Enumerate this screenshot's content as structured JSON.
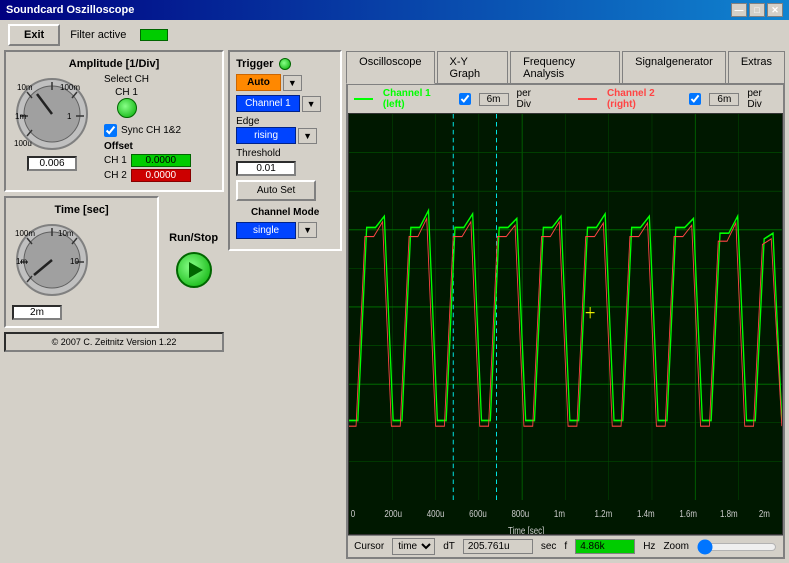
{
  "window": {
    "title": "Soundcard Oszilloscope",
    "min_btn": "—",
    "max_btn": "□",
    "close_btn": "✕"
  },
  "toolbar": {
    "exit_label": "Exit",
    "filter_active_label": "Filter active"
  },
  "tabs": [
    {
      "id": "oscilloscope",
      "label": "Oscilloscope",
      "active": true
    },
    {
      "id": "xy-graph",
      "label": "X-Y Graph",
      "active": false
    },
    {
      "id": "frequency-analysis",
      "label": "Frequency Analysis",
      "active": false
    },
    {
      "id": "signalgenerator",
      "label": "Signalgenerator",
      "active": false
    },
    {
      "id": "extras",
      "label": "Extras",
      "active": false
    }
  ],
  "channel_bar": {
    "ch1_label": "Channel 1 (left)",
    "ch1_checked": true,
    "ch1_per_div": "6m",
    "ch1_per_div_unit": "per Div",
    "ch2_label": "Channel 2 (right)",
    "ch2_checked": true,
    "ch2_per_div": "6m",
    "ch2_per_div_unit": "per Div"
  },
  "amplitude": {
    "title": "Amplitude [1/Div]",
    "labels_outer": [
      "10m",
      "100m"
    ],
    "labels_inner": [
      "1m",
      "1"
    ],
    "label_bottom": "100u",
    "spinner_value": "0.006"
  },
  "select_ch": {
    "label": "Select CH",
    "ch_label": "CH 1",
    "sync_label": "Sync CH 1&2"
  },
  "offset": {
    "label": "Offset",
    "ch1_label": "CH 1",
    "ch1_value": "0.0000",
    "ch2_label": "CH 2",
    "ch2_value": "0.0000"
  },
  "time": {
    "title": "Time [sec]",
    "labels": [
      "100m",
      "10m",
      "1",
      "1m",
      "10"
    ],
    "spinner_value": "2m"
  },
  "trigger": {
    "title": "Trigger",
    "auto_label": "Auto",
    "channel_label": "Channel 1",
    "edge_label": "Edge",
    "rising_label": "rising",
    "threshold_label": "Threshold",
    "threshold_value": "0.01",
    "auto_set_label": "Auto Set"
  },
  "channel_mode": {
    "label": "Channel Mode",
    "mode_label": "single"
  },
  "run_stop": {
    "title": "Run/Stop"
  },
  "copyright": {
    "text": "© 2007  C. Zeitnitz Version 1.22"
  },
  "cursor": {
    "label": "Cursor",
    "type": "time",
    "dt_label": "dT",
    "dt_value": "205.761u",
    "dt_unit": "sec",
    "f_label": "f",
    "f_value": "4.86k",
    "f_unit": "Hz",
    "zoom_label": "Zoom"
  },
  "x_axis": {
    "labels": [
      "0",
      "200u",
      "400u",
      "600u",
      "800u",
      "1m",
      "1.2m",
      "1.4m",
      "1.6m",
      "1.8m",
      "2m"
    ],
    "unit_label": "Time [sec]"
  }
}
